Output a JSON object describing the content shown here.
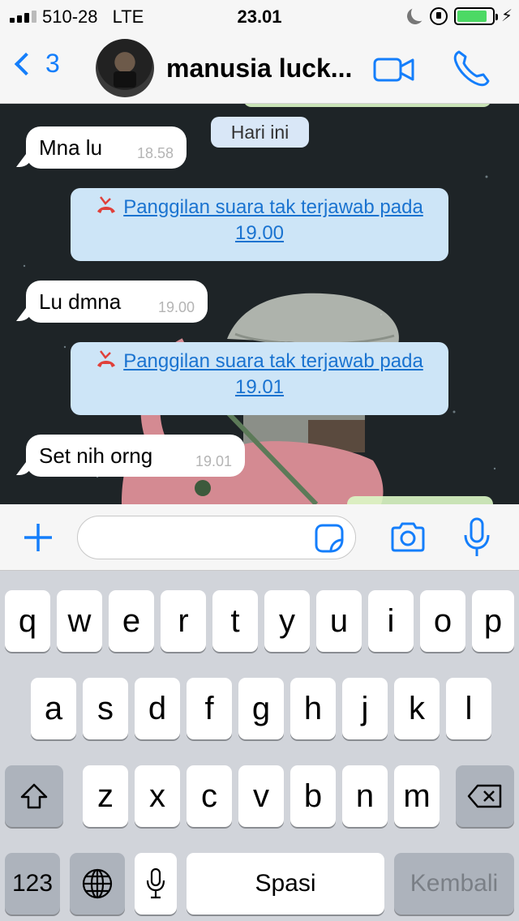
{
  "status_bar": {
    "carrier": "510-28",
    "network": "LTE",
    "time": "23.01",
    "battery_level": 0.85,
    "signal_bars_total": 4,
    "signal_bars_active": 3
  },
  "header": {
    "back_count": "3",
    "contact_name": "manusia luck...",
    "icons": [
      "chevron-left-icon",
      "video-call-icon",
      "phone-call-icon"
    ]
  },
  "chat": {
    "date_divider": "Hari ini",
    "messages": [
      {
        "type": "incoming",
        "text": "Mna lu",
        "time": "18.58"
      },
      {
        "type": "missed_call",
        "line1": "Panggilan suara tak terjawab pada",
        "line2": "19.00"
      },
      {
        "type": "incoming",
        "text": "Lu dmna",
        "time": "19.00"
      },
      {
        "type": "missed_call",
        "line1": "Panggilan suara tak terjawab pada",
        "line2": "19.01"
      },
      {
        "type": "incoming",
        "text": "Set nih orng",
        "time": "19.01"
      }
    ]
  },
  "input_bar": {
    "text_value": "",
    "icons": [
      "plus-icon",
      "sticker-icon",
      "camera-icon",
      "microphone-icon"
    ]
  },
  "keyboard": {
    "row1": [
      "q",
      "w",
      "e",
      "r",
      "t",
      "y",
      "u",
      "i",
      "o",
      "p"
    ],
    "row2": [
      "a",
      "s",
      "d",
      "f",
      "g",
      "h",
      "j",
      "k",
      "l"
    ],
    "row3": [
      "z",
      "x",
      "c",
      "v",
      "b",
      "n",
      "m"
    ],
    "numbers_key": "123",
    "space_key": "Spasi",
    "return_key": "Kembali",
    "icons": [
      "shift-icon",
      "backspace-icon",
      "globe-icon",
      "dictation-mic-icon"
    ]
  },
  "colors": {
    "accent": "#147efb",
    "chat_background": "#1e2427",
    "missed_call_card": "#cde5f7",
    "missed_call_icon": "#e0403a",
    "keyboard_background": "#d1d4da"
  }
}
